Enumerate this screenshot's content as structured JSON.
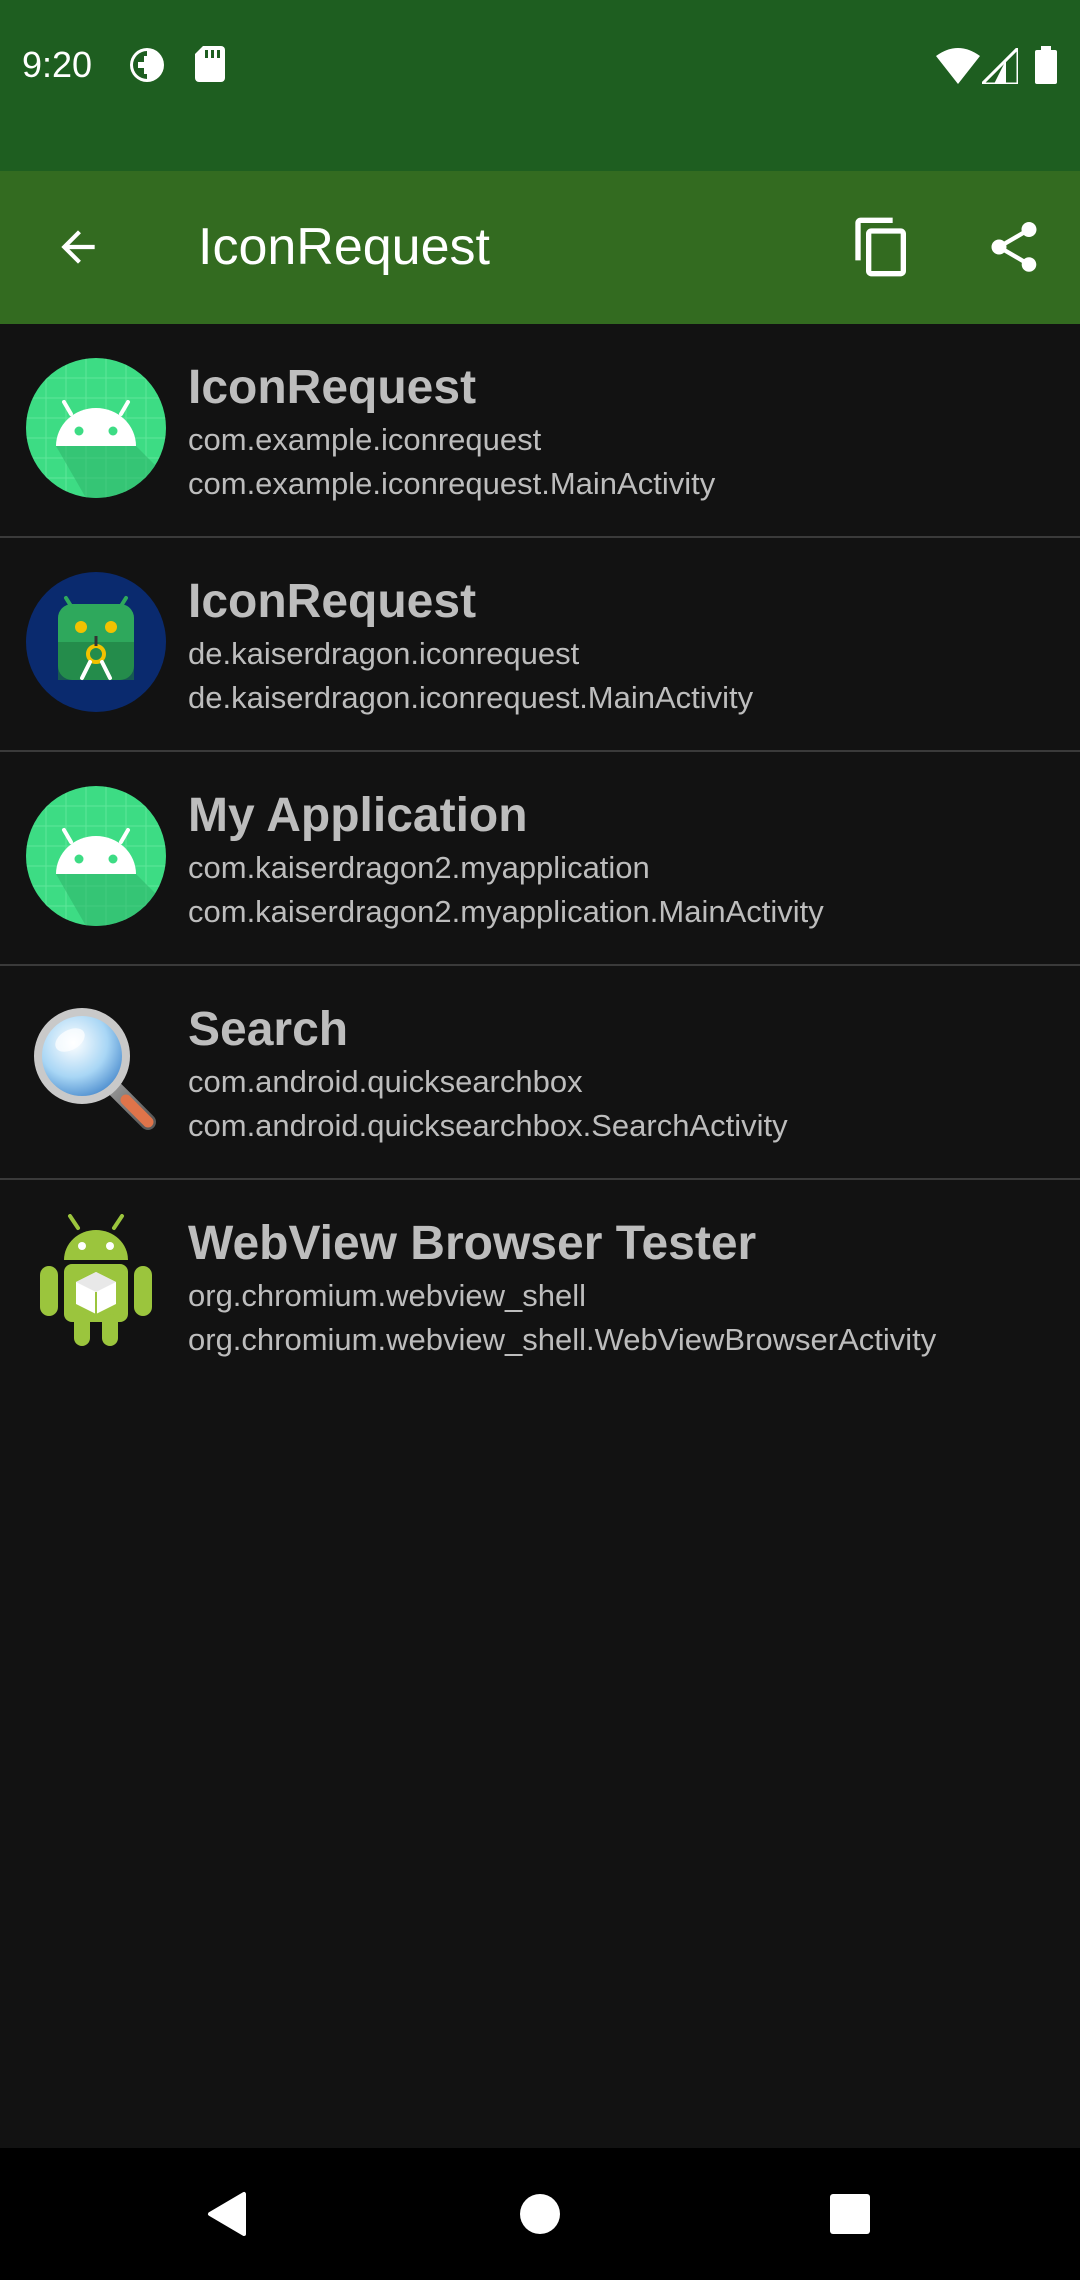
{
  "status_bar": {
    "time": "9:20",
    "icons": [
      "data-saver-icon",
      "sd-card-icon",
      "wifi-icon",
      "signal-icon",
      "battery-icon"
    ]
  },
  "app_bar": {
    "title": "IconRequest",
    "back_icon": "arrow-back-icon",
    "copy_icon": "copy-icon",
    "share_icon": "share-icon"
  },
  "apps": [
    {
      "name": "IconRequest",
      "package": "com.example.iconrequest",
      "activity": "com.example.iconrequest.MainActivity",
      "icon": "android-default-icon"
    },
    {
      "name": "IconRequest",
      "package": "de.kaiserdragon.iconrequest",
      "activity": "de.kaiserdragon.iconrequest.MainActivity",
      "icon": "iconrequest-app-icon"
    },
    {
      "name": "My Application",
      "package": "com.kaiserdragon2.myapplication",
      "activity": "com.kaiserdragon2.myapplication.MainActivity",
      "icon": "android-default-icon"
    },
    {
      "name": "Search",
      "package": "com.android.quicksearchbox",
      "activity": "com.android.quicksearchbox.SearchActivity",
      "icon": "magnifier-icon"
    },
    {
      "name": "WebView Browser Tester",
      "package": "org.chromium.webview_shell",
      "activity": "org.chromium.webview_shell.WebViewBrowserActivity",
      "icon": "android-robot-icon"
    }
  ],
  "nav_bar": {
    "back_icon": "nav-back-icon",
    "home_icon": "nav-home-icon",
    "recents_icon": "nav-recents-icon"
  },
  "colors": {
    "status_bar": "#1e5e20",
    "app_bar": "#336b20",
    "background": "#121212",
    "text": "#bdbdbd",
    "android_green": "#3ddc84"
  }
}
